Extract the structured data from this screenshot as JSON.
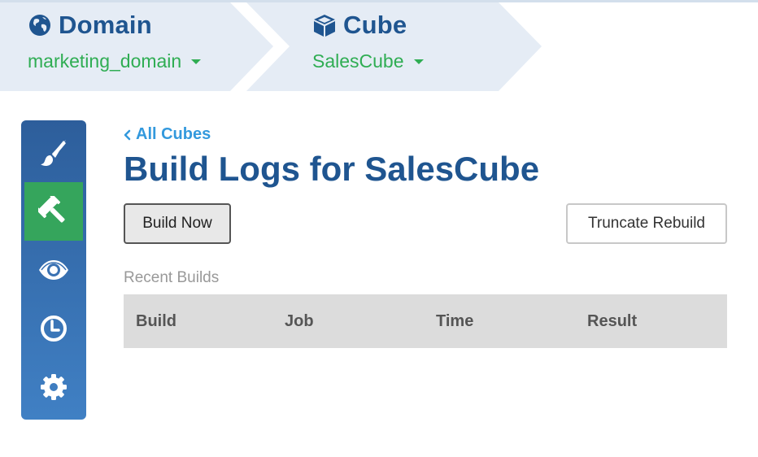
{
  "breadcrumb": {
    "domain": {
      "title": "Domain",
      "icon": "globe-icon",
      "value": "marketing_domain"
    },
    "cube": {
      "title": "Cube",
      "icon": "cube-icon",
      "value": "SalesCube"
    }
  },
  "sidebar": {
    "items": [
      {
        "name": "design",
        "icon": "paintbrush-icon",
        "active": false
      },
      {
        "name": "build",
        "icon": "gavel-icon",
        "active": true
      },
      {
        "name": "preview",
        "icon": "eye-icon",
        "active": false
      },
      {
        "name": "history",
        "icon": "clock-icon",
        "active": false
      },
      {
        "name": "settings",
        "icon": "gear-icon",
        "active": false
      }
    ]
  },
  "main": {
    "back_link": "All Cubes",
    "title": "Build Logs for SalesCube",
    "build_now_label": "Build Now",
    "truncate_label": "Truncate Rebuild",
    "section_label": "Recent Builds",
    "table": {
      "columns": [
        "Build",
        "Job",
        "Time",
        "Result"
      ],
      "rows": []
    }
  },
  "colors": {
    "brand_blue": "#1f5590",
    "accent_green": "#2fad53",
    "link_blue": "#3399dd",
    "header_band": "#e5ecf5"
  }
}
